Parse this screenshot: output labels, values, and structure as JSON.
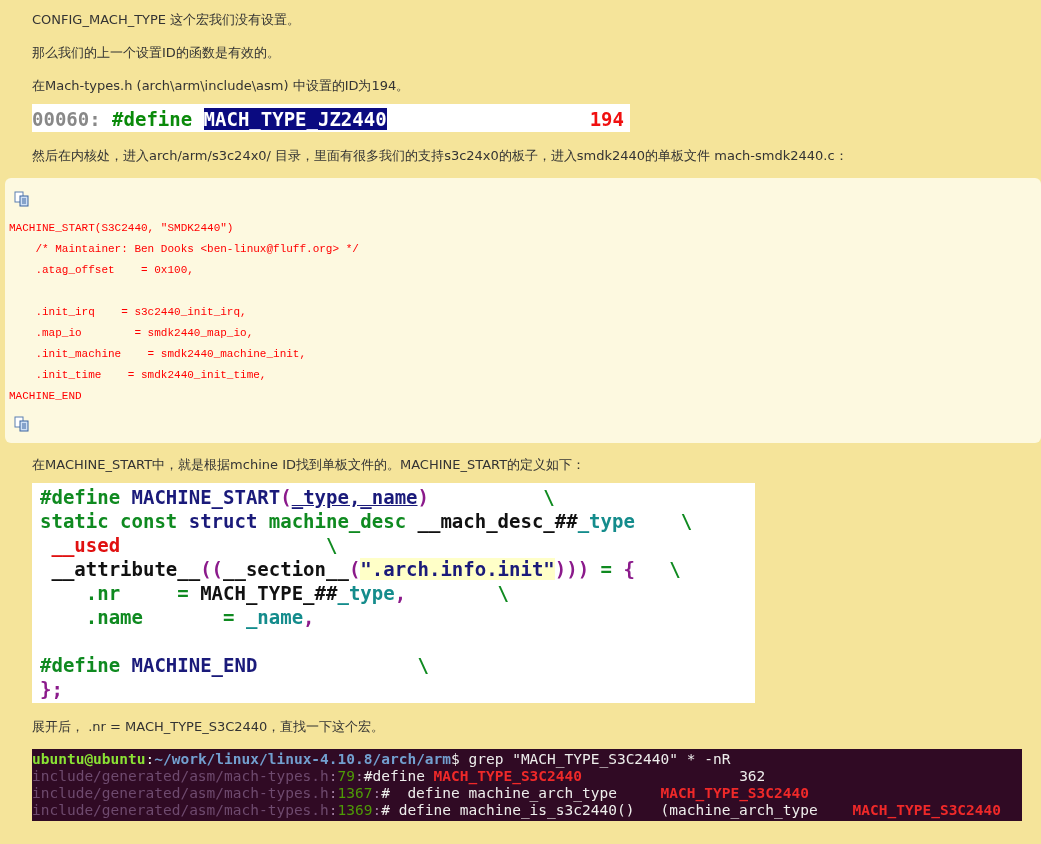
{
  "blocks": [
    {
      "kind": "text",
      "text": "CONFIG_MACH_TYPE 这个宏我们没有设置。"
    },
    {
      "kind": "text",
      "text": "那么我们的上一个设置ID的函数是有效的。"
    },
    {
      "kind": "text",
      "text": "在Mach-types.h (arch\\arm\\include\\asm) 中设置的ID为194。"
    },
    {
      "kind": "define_strip",
      "segments": [
        {
          "text": "00060:",
          "kind": "lineno"
        },
        {
          "text": " #define ",
          "kind": "keyword"
        },
        {
          "text": "MACH_TYPE_JZ2440",
          "kind": "highlight"
        }
      ],
      "value": "194"
    },
    {
      "kind": "text",
      "text": "然后在内核处，进入arch/arm/s3c24x0/ 目录，里面有很多我们的支持s3c24x0的板子，进入smdk2440的单板文件 mach-smdk2440.c："
    },
    {
      "kind": "code_box",
      "lines": [
        "MACHINE_START(S3C2440, \"SMDK2440\")",
        "    /* Maintainer: Ben Dooks <ben-linux@fluff.org> */",
        "    .atag_offset    = 0x100,",
        "\n    .init_irq    = s3c2440_init_irq,",
        "    .map_io        = smdk2440_map_io,",
        "    .init_machine    = smdk2440_machine_init,",
        "    .init_time    = smdk2440_init_time,",
        "MACHINE_END"
      ]
    },
    {
      "kind": "text",
      "text": "在MACHINE_START中，就是根据mchine ID找到单板文件的。MACHINE_START的定义如下："
    },
    {
      "kind": "code_image",
      "lines": [
        [
          {
            "text": "#define",
            "kind": "keyword"
          },
          {
            "text": " MACHINE_START",
            "kind": "name"
          },
          {
            "text": "(",
            "kind": "punct"
          },
          {
            "text": "_type,_name",
            "kind": "underlined"
          },
          {
            "text": ")",
            "kind": "punct"
          },
          {
            "text": "          \\",
            "kind": "keyword"
          }
        ],
        [
          {
            "text": "static const",
            "kind": "keyword"
          },
          {
            "text": " struct",
            "kind": "name"
          },
          {
            "text": " machine_desc",
            "kind": "keyword"
          },
          {
            "text": " __mach_desc_##",
            "kind": "plain"
          },
          {
            "text": "_type",
            "kind": "param"
          },
          {
            "text": "    \\",
            "kind": "keyword"
          }
        ],
        [
          {
            "text": " __used",
            "kind": "used"
          },
          {
            "text": "                  \\",
            "kind": "keyword"
          }
        ],
        [
          {
            "text": " __attribute__",
            "kind": "plain"
          },
          {
            "text": "((",
            "kind": "punct"
          },
          {
            "text": "__section__",
            "kind": "plain"
          },
          {
            "text": "(",
            "kind": "punct"
          },
          {
            "text": "\".arch.info.init\"",
            "kind": "string"
          },
          {
            "text": ")))",
            "kind": "punct"
          },
          {
            "text": " = ",
            "kind": "keyword"
          },
          {
            "text": "{",
            "kind": "punct"
          },
          {
            "text": "   \\",
            "kind": "keyword"
          }
        ],
        [
          {
            "text": "    .nr",
            "kind": "keyword"
          },
          {
            "text": "     = ",
            "kind": "keyword"
          },
          {
            "text": "MACH_TYPE_##",
            "kind": "plain"
          },
          {
            "text": "_type",
            "kind": "param"
          },
          {
            "text": ",",
            "kind": "punct"
          },
          {
            "text": "        \\",
            "kind": "keyword"
          }
        ],
        [
          {
            "text": "    .name",
            "kind": "keyword"
          },
          {
            "text": "       = ",
            "kind": "keyword"
          },
          {
            "text": "_name",
            "kind": "param"
          },
          {
            "text": ",",
            "kind": "punct"
          }
        ],
        [
          {
            "text": "\n#define",
            "kind": "keyword"
          },
          {
            "text": " MACHINE_END",
            "kind": "name"
          },
          {
            "text": "              \\",
            "kind": "keyword"
          }
        ],
        [
          {
            "text": "};",
            "kind": "punct"
          }
        ]
      ]
    },
    {
      "kind": "text",
      "text": "展开后， .nr = MACH_TYPE_S3C2440，直找一下这个宏。"
    },
    {
      "kind": "terminal",
      "lines": [
        [
          {
            "text": "ubuntu@ubuntu",
            "kind": "user"
          },
          {
            "text": ":",
            "kind": "plain"
          },
          {
            "text": "~/work/linux/linux-4.10.8/arch/arm",
            "kind": "dir"
          },
          {
            "text": "$ grep \"MACH_TYPE_S3C2440\" * -nR",
            "kind": "plain"
          }
        ],
        [
          {
            "text": "include/generated/asm/mach-types.h",
            "kind": "path"
          },
          {
            "text": ":",
            "kind": "sep"
          },
          {
            "text": "79",
            "kind": "lineno"
          },
          {
            "text": ":",
            "kind": "sep"
          },
          {
            "text": "#define ",
            "kind": "plain"
          },
          {
            "text": "MACH_TYPE_S3C2440",
            "kind": "match"
          },
          {
            "text": "                  362",
            "kind": "plain"
          }
        ],
        [
          {
            "text": "include/generated/asm/mach-types.h",
            "kind": "path"
          },
          {
            "text": ":",
            "kind": "sep"
          },
          {
            "text": "1367",
            "kind": "lineno"
          },
          {
            "text": ":",
            "kind": "sep"
          },
          {
            "text": "#  define machine_arch_type     ",
            "kind": "plain"
          },
          {
            "text": "MACH_TYPE_S3C2440",
            "kind": "match"
          }
        ],
        [
          {
            "text": "include/generated/asm/mach-types.h",
            "kind": "path"
          },
          {
            "text": ":",
            "kind": "sep"
          },
          {
            "text": "1369",
            "kind": "lineno"
          },
          {
            "text": ":",
            "kind": "sep"
          },
          {
            "text": "# define machine_is_s3c2440()   (machine_arch_type    ",
            "kind": "plain"
          },
          {
            "text": "MACH_TYPE_S3C2440",
            "kind": "match"
          }
        ]
      ]
    }
  ]
}
